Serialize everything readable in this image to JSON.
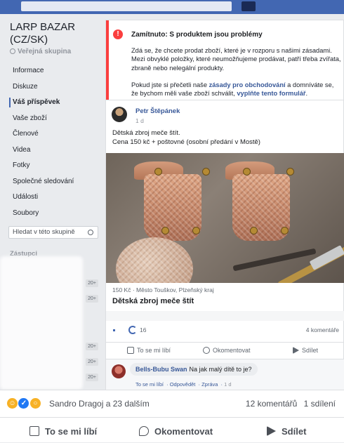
{
  "group": {
    "name": "LARP BAZAR (CZ/SK)",
    "type": "Veřejná skupina",
    "nav": [
      {
        "label": "Informace",
        "active": false
      },
      {
        "label": "Diskuze",
        "active": false
      },
      {
        "label": "Váš příspěvek",
        "active": true
      },
      {
        "label": "Vaše zboží",
        "active": false
      },
      {
        "label": "Členové",
        "active": false
      },
      {
        "label": "Videa",
        "active": false
      },
      {
        "label": "Fotky",
        "active": false
      },
      {
        "label": "Společné sledování",
        "active": false
      },
      {
        "label": "Události",
        "active": false
      },
      {
        "label": "Soubory",
        "active": false
      }
    ],
    "search_placeholder": "Hledat v této skupině",
    "admins_label": "Zástupci",
    "admin_badges": [
      "20+",
      "20+",
      "20+",
      "20+",
      "20+"
    ]
  },
  "notice": {
    "badge": "!",
    "title": "Zamítnuto: S produktem jsou problémy",
    "para1": "Zdá se, že chcete prodat zboží, které je v rozporu s našimi zásadami. Mezi obvyklé položky, které neumožňujeme prodávat, patří třeba zvířata, zbraně nebo nelegální produkty.",
    "para2_pre": "Pokud jste si přečetli naše ",
    "para2_link1": "zásady pro obchodování",
    "para2_mid": " a domníváte se, že bychom měli vaše zboží schválit, ",
    "para2_link2": "vyplňte tento formulář",
    "para2_end": "."
  },
  "post": {
    "author": "Petr Štěpánek",
    "time": "1 d",
    "text_line1": "Dětská zbroj meče štít.",
    "text_line2": "Cena 150 kč + poštovné (osobní předání v Mostě)",
    "listing_meta": "150 Kč · Město Touškov, Plzeňský kraj",
    "listing_title": "Dětská zbroj meče štít",
    "reaction_count": "16",
    "comment_count": "4 komentáře",
    "actions": {
      "like": "To se mi líbí",
      "comment": "Okomentovat",
      "share": "Sdílet"
    },
    "comment": {
      "name": "Bells-Bubu Swan",
      "text": "Na jak malý dítě to je?",
      "like": "To se mi líbí",
      "reply": "Odpovědět",
      "message": "Zpráva",
      "time": "1 d"
    }
  },
  "footer": {
    "reactions_text": "Sandro Dragoj a 23 dalším",
    "comments": "12 komentářů",
    "shares": "1 sdílení",
    "actions": {
      "like": "To se mi líbí",
      "comment": "Okomentovat",
      "share": "Sdílet"
    }
  }
}
